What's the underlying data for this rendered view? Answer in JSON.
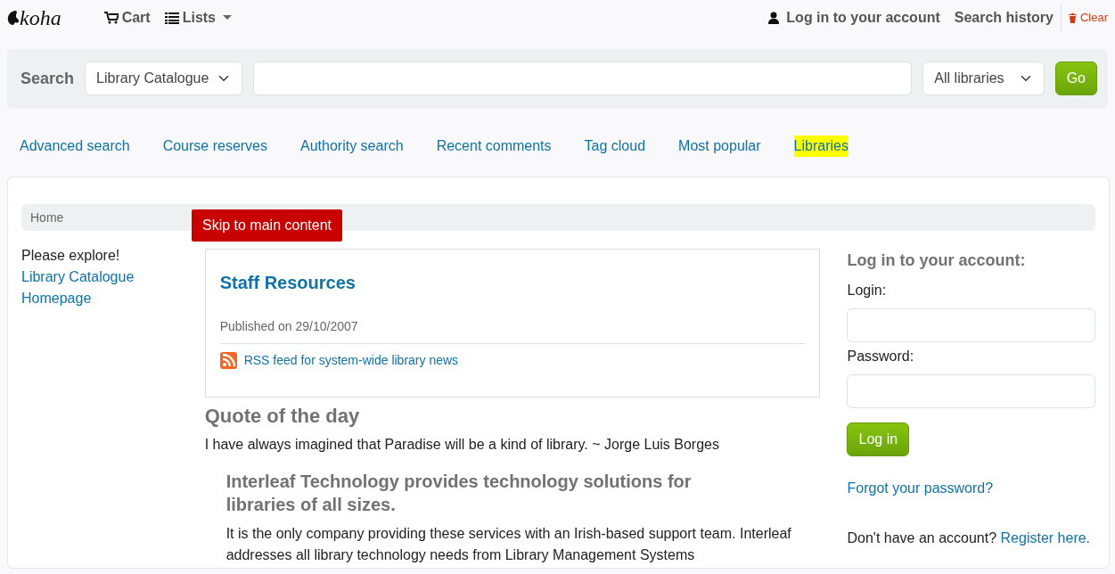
{
  "header": {
    "logo": "koha",
    "cart": "Cart",
    "lists": "Lists",
    "login": "Log in to your account",
    "search_history": "Search history",
    "clear": "Clear"
  },
  "search": {
    "label": "Search",
    "scope": "Library Catalogue",
    "library": "All libraries",
    "button": "Go"
  },
  "nav_links": [
    {
      "label": "Advanced search",
      "highlighted": false
    },
    {
      "label": "Course reserves",
      "highlighted": false
    },
    {
      "label": "Authority search",
      "highlighted": false
    },
    {
      "label": "Recent comments",
      "highlighted": false
    },
    {
      "label": "Tag cloud",
      "highlighted": false
    },
    {
      "label": "Most popular",
      "highlighted": false
    },
    {
      "label": "Libraries",
      "highlighted": true
    }
  ],
  "breadcrumb": [
    "Home"
  ],
  "skip_link": "Skip to main content",
  "sidebar": {
    "heading": "Please explore!",
    "links": [
      "Library Catalogue",
      "Homepage"
    ]
  },
  "news": {
    "title": "Staff Resources",
    "published": "Published on 29/10/2007",
    "rss": "RSS feed for system-wide library news"
  },
  "quote": {
    "heading": "Quote of the day",
    "text": "I have always imagined that Paradise will be a kind of library. ~ Jorge Luis Borges"
  },
  "promo": {
    "heading": "Interleaf Technology provides technology solutions for libraries of all sizes.",
    "text": "It is the only company providing these services with an Irish-based support team. Interleaf addresses all library technology needs from Library Management Systems"
  },
  "login": {
    "heading": "Log in to your account:",
    "login_label": "Login:",
    "password_label": "Password:",
    "button": "Log in",
    "forgot": "Forgot your password?",
    "register_text": "Don't have an account?",
    "register_link": "Register here."
  }
}
